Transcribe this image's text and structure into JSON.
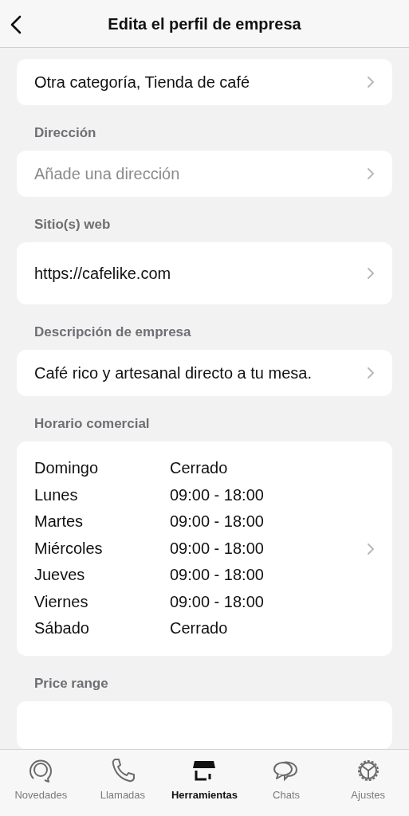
{
  "header": {
    "title": "Edita el perfil de empresa"
  },
  "sections": [
    {
      "kind": "value",
      "value": "Otra categoría, Tienda de café"
    },
    {
      "kind": "placeholder",
      "label": "Dirección",
      "placeholder": "Añade una dirección"
    },
    {
      "kind": "value",
      "label": "Sitio(s) web",
      "value": "https://cafelike.com",
      "tall": true
    },
    {
      "kind": "value",
      "label": "Descripción de empresa",
      "value": "Café rico y artesanal directo a tu mesa."
    },
    {
      "kind": "hours",
      "label": "Horario comercial",
      "rows": [
        {
          "day": "Domingo",
          "hours": "Cerrado"
        },
        {
          "day": "Lunes",
          "hours": "09:00 - 18:00"
        },
        {
          "day": "Martes",
          "hours": "09:00 - 18:00"
        },
        {
          "day": "Miércoles",
          "hours": "09:00 - 18:00"
        },
        {
          "day": "Jueves",
          "hours": "09:00 - 18:00"
        },
        {
          "day": "Viernes",
          "hours": "09:00 - 18:00"
        },
        {
          "day": "Sábado",
          "hours": "Cerrado"
        }
      ]
    },
    {
      "kind": "empty",
      "label": "Price range"
    }
  ],
  "tabs": [
    {
      "kind": "updates",
      "label": "Novedades",
      "selected": false
    },
    {
      "kind": "calls",
      "label": "Llamadas",
      "selected": false
    },
    {
      "kind": "tools",
      "label": "Herramientas",
      "selected": true
    },
    {
      "kind": "chats",
      "label": "Chats",
      "selected": false
    },
    {
      "kind": "settings",
      "label": "Ajustes",
      "selected": false
    }
  ]
}
